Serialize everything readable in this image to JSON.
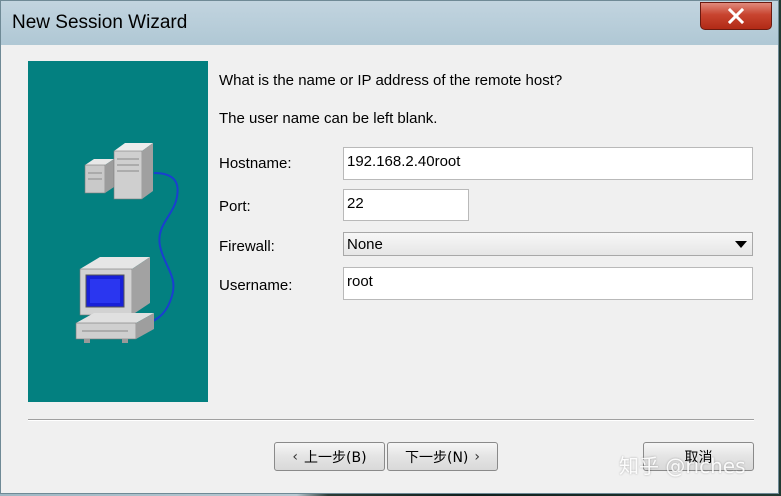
{
  "window": {
    "title": "New Session Wizard"
  },
  "illustration": {
    "background": "#038080",
    "icons": [
      "server-icon",
      "computer-icon"
    ]
  },
  "form": {
    "question": "What is the name or IP address of the remote host?",
    "note": "The user name can be left blank.",
    "hostname": {
      "label": "Hostname:",
      "value": "192.168.2.40root"
    },
    "port": {
      "label": "Port:",
      "value": "22"
    },
    "firewall": {
      "label": "Firewall:",
      "value": "None"
    },
    "username": {
      "label": "Username:",
      "value": "root"
    }
  },
  "buttons": {
    "back_label": "上一步(B)",
    "next_label": "下一步(N)",
    "cancel_label": "取消"
  },
  "watermark": {
    "text": "知乎 @riches"
  },
  "colors": {
    "accent": "#038080",
    "close": "#c8442f"
  }
}
